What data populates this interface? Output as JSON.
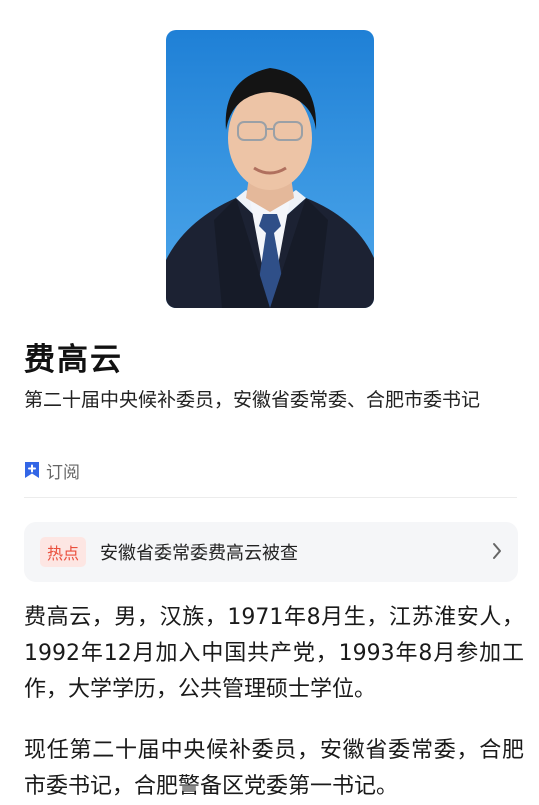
{
  "profile": {
    "name": "费高云",
    "title": "第二十届中央候补委员，安徽省委常委、合肥市委书记",
    "subscribe_label": "订阅",
    "subscribe_icon": "bookmark-plus-icon",
    "accent": "#3366e6"
  },
  "hot_topic": {
    "tag": "热点",
    "text": "安徽省委常委费高云被查",
    "icon": "chevron-right-icon",
    "tag_color": "#ea4f3c"
  },
  "bio": {
    "paragraph1": "费高云，男，汉族，1971年8月生，江苏淮安人，1992年12月加入中国共产党，1993年8月参加工作，大学学历，公共管理硕士学位。",
    "paragraph2": "现任第二十届中央候补委员，安徽省委常委，合肥市委书记，合肥警备区党委第一书记。"
  }
}
